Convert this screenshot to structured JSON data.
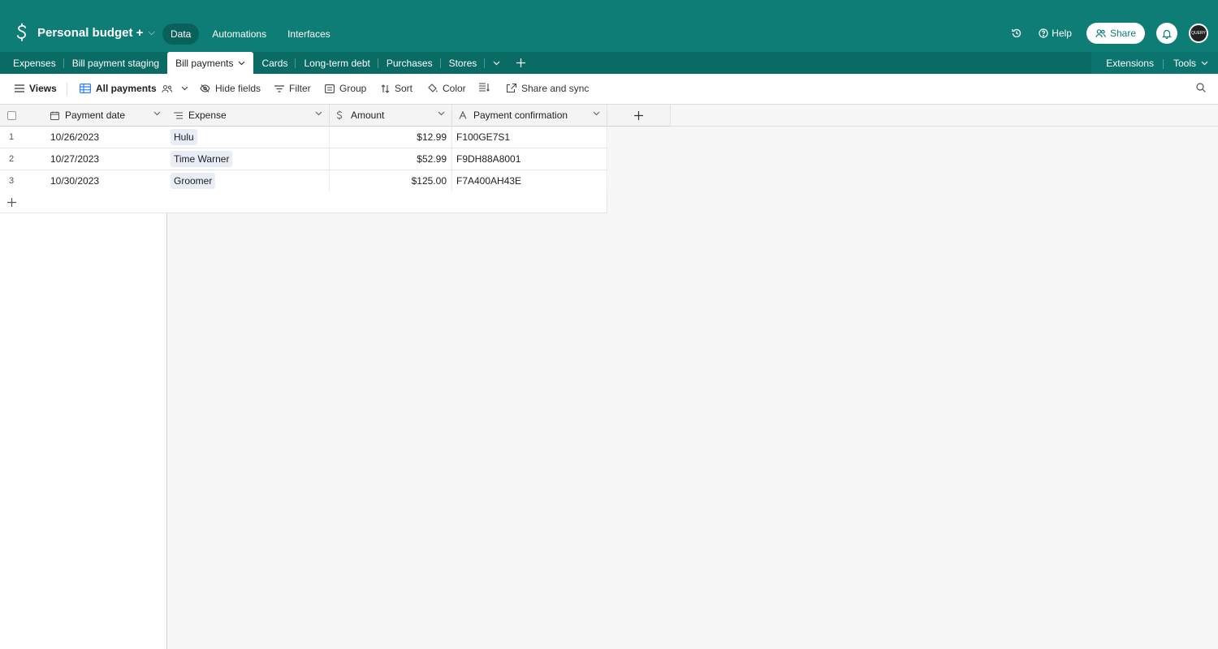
{
  "app": {
    "base_name": "Personal budget +",
    "nav": [
      "Data",
      "Automations",
      "Interfaces"
    ],
    "help_label": "Help",
    "share_label": "Share",
    "avatar_text": "QUERY",
    "brand_color": "#0d7d76"
  },
  "tabs": {
    "items": [
      "Expenses",
      "Bill payment staging",
      "Bill payments",
      "Cards",
      "Long-term debt",
      "Purchases",
      "Stores"
    ],
    "active": "Bill payments",
    "extensions_label": "Extensions",
    "tools_label": "Tools"
  },
  "toolbar": {
    "views_label": "Views",
    "view_name": "All payments",
    "hide_fields": "Hide fields",
    "filter": "Filter",
    "group": "Group",
    "sort": "Sort",
    "color": "Color",
    "share_sync": "Share and sync"
  },
  "table": {
    "columns": [
      "Payment date",
      "Expense",
      "Amount",
      "Payment confirmation"
    ],
    "column_icons": [
      "calendar-icon",
      "link-icon",
      "currency-icon",
      "text-icon"
    ],
    "rows": [
      {
        "num": "1",
        "date": "10/26/2023",
        "expense": "Hulu",
        "amount": "$12.99",
        "confirmation": "F100GE7S1"
      },
      {
        "num": "2",
        "date": "10/27/2023",
        "expense": "Time Warner",
        "amount": "$52.99",
        "confirmation": "F9DH88A8001"
      },
      {
        "num": "3",
        "date": "10/30/2023",
        "expense": "Groomer",
        "amount": "$125.00",
        "confirmation": "F7A400AH43E"
      }
    ]
  }
}
